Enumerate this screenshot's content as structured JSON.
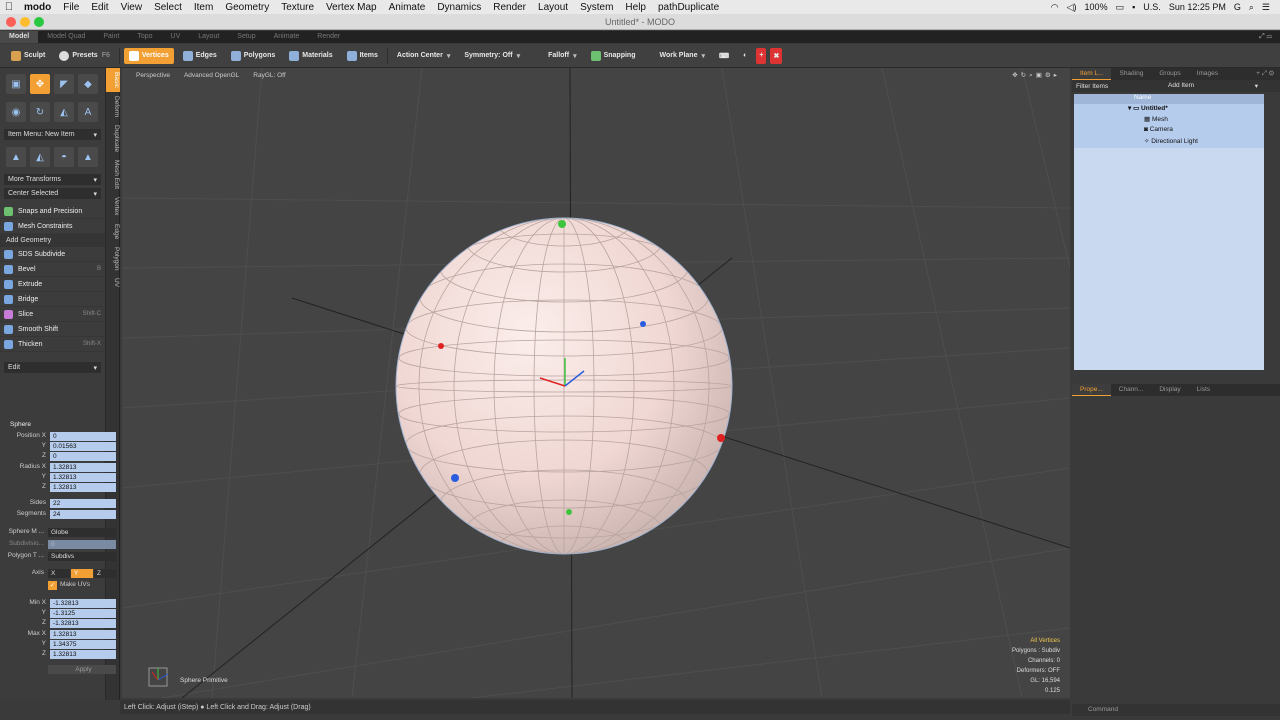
{
  "mac_menu": {
    "app": "modo",
    "items": [
      "File",
      "Edit",
      "View",
      "Select",
      "Item",
      "Geometry",
      "Texture",
      "Vertex Map",
      "Animate",
      "Dynamics",
      "Render",
      "Layout",
      "System",
      "Help",
      "pathDuplicate"
    ],
    "battery": "100%",
    "input_source": "U.S.",
    "clock": "Sun 12:25 PM",
    "user_initial": "G"
  },
  "window": {
    "title": "Untitled* - MODO"
  },
  "layout_tabs": [
    "Model",
    "Model Quad",
    "Paint",
    "Topo",
    "UV",
    "Layout",
    "Setup",
    "Animate",
    "Render"
  ],
  "toolbar": {
    "sculpt": "Sculpt",
    "presets": "Presets",
    "presets_key": "F6",
    "vertices": "Vertices",
    "edges": "Edges",
    "polygons": "Polygons",
    "materials": "Materials",
    "items": "Items",
    "action_center": "Action Center",
    "symmetry": "Symmetry: Off",
    "falloff": "Falloff",
    "snapping": "Snapping",
    "work_plane": "Work Plane"
  },
  "left_vtabs": [
    "Basic",
    "Deform",
    "Duplicate",
    "Mesh Edit",
    "Vertex",
    "Edge",
    "Polygon",
    "UV"
  ],
  "left_panel": {
    "item_menu": "Item Menu: New Item",
    "more_transforms": "More Transforms",
    "center_selected": "Center Selected",
    "snaps": "Snaps and Precision",
    "constraints": "Mesh Constraints",
    "add_geometry": "Add Geometry",
    "tools": [
      {
        "label": "SDS Subdivide",
        "shortcut": ""
      },
      {
        "label": "Bevel",
        "shortcut": "B"
      },
      {
        "label": "Extrude",
        "shortcut": ""
      },
      {
        "label": "Bridge",
        "shortcut": ""
      },
      {
        "label": "Slice",
        "shortcut": "Shift-C"
      },
      {
        "label": "Smooth Shift",
        "shortcut": ""
      },
      {
        "label": "Thicken",
        "shortcut": "Shift-X"
      }
    ],
    "edit": "Edit"
  },
  "sphere_props": {
    "header": "Sphere",
    "position_label": "Position X",
    "pos_x": "0",
    "pos_y": "0.01563",
    "pos_z": "0",
    "radius_label": "Radius X",
    "rad_x": "1.32813",
    "rad_y": "1.32813",
    "rad_z": "1.32813",
    "y": "Y",
    "z": "Z",
    "sides_label": "Sides",
    "sides": "22",
    "segments_label": "Segments",
    "segments": "24",
    "sphere_mode_label": "Sphere M ...",
    "sphere_mode": "Globe",
    "subdiv_label": "Subdivisio...",
    "subdiv": "0",
    "poly_type_label": "Polygon T ...",
    "poly_type": "Subdivs",
    "axis_label": "Axis",
    "axis_x": "X",
    "axis_y": "Y",
    "axis_z": "Z",
    "make_uvs": "Make UVs",
    "min_label": "Min X",
    "min_x": "-1.32813",
    "min_y": "-1.3125",
    "min_z": "-1.32813",
    "max_label": "Max X",
    "max_x": "1.32813",
    "max_y": "1.34375",
    "max_z": "1.32813",
    "apply": "Apply"
  },
  "viewport": {
    "view": "Perspective",
    "shading": "Advanced OpenGL",
    "raygl": "RayGL: Off",
    "tool_label": "Sphere Primitive",
    "info": [
      "All Vertices",
      "Polygons : Subdiv",
      "Channels: 0",
      "Deformers: OFF",
      "GL: 16,594",
      "0.125"
    ]
  },
  "items_panel": {
    "tabs": [
      "Item L...",
      "Shading",
      "Groups",
      "Images"
    ],
    "filter": "Filter Items",
    "add_item": "Add Item",
    "col_name": "Name",
    "tree": [
      "Untitled*",
      "Mesh",
      "Camera",
      "Directional Light"
    ]
  },
  "props_panel": {
    "tabs": [
      "Prope...",
      "Chann...",
      "Display",
      "Lists"
    ]
  },
  "status": {
    "text": "Left Click: Adjust (iStep) ● Left Click and Drag: Adjust (Drag)"
  },
  "command": {
    "placeholder": "Command"
  },
  "colors": {
    "accent": "#f29f34",
    "field": "#b6ccec",
    "sphere": "#f3dcd8"
  }
}
